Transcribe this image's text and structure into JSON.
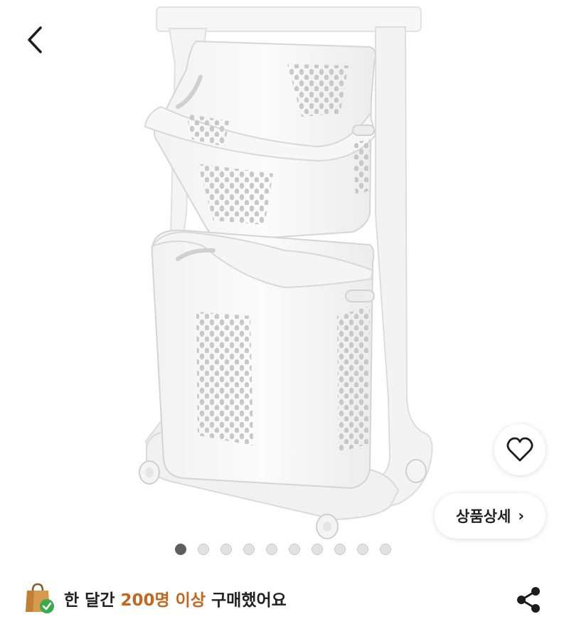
{
  "gallery": {
    "slide_count": 10,
    "active_index": 0
  },
  "detail_button": {
    "label": "상품상세",
    "chevron": "›"
  },
  "purchase_info": {
    "prefix": "한 달간 ",
    "highlight": "200명 이상",
    "suffix": " 구매했어요"
  },
  "icons": {
    "back": "chevron-left-icon",
    "wish": "heart-outline-icon",
    "shopping_bag": "shopping-bag-check-icon",
    "share": "share-icon"
  },
  "colors": {
    "highlight": "#c4661f",
    "badge_green": "#3aaa4a",
    "active_dot": "#5e5e5e"
  }
}
